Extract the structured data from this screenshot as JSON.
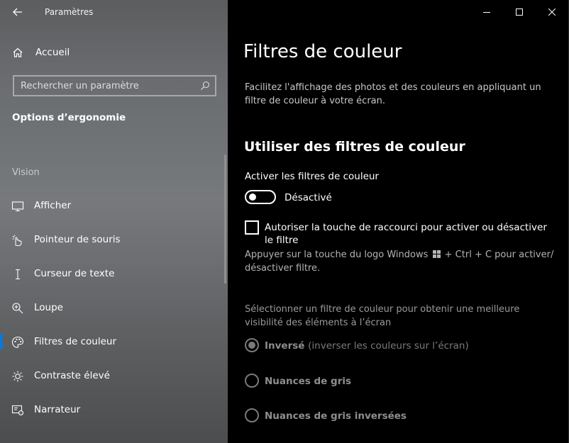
{
  "app": {
    "title": "Paramètres"
  },
  "sidebar": {
    "home_label": "Accueil",
    "search_placeholder": "Rechercher un paramètre",
    "section_title": "Options d’ergonomie",
    "group_label": "Vision",
    "items": [
      {
        "label": "Afficher",
        "icon": "display-icon"
      },
      {
        "label": "Pointeur de souris",
        "icon": "mouse-pointer-icon"
      },
      {
        "label": "Curseur de texte",
        "icon": "text-cursor-icon"
      },
      {
        "label": "Loupe",
        "icon": "magnifier-icon"
      },
      {
        "label": "Filtres de couleur",
        "icon": "palette-icon",
        "selected": true
      },
      {
        "label": "Contraste élevé",
        "icon": "contrast-icon"
      },
      {
        "label": "Narrateur",
        "icon": "narrator-icon"
      }
    ]
  },
  "main": {
    "title": "Filtres de couleur",
    "description": "Facilitez l'affichage des photos et des couleurs en appliquant un filtre de couleur à votre écran.",
    "subtitle": "Utiliser des filtres de couleur",
    "toggle": {
      "label": "Activer les filtres de couleur",
      "state_text": "Désactivé",
      "on": false
    },
    "shortcut": {
      "label": "Autoriser la touche de raccourci pour activer ou désactiver le filtre",
      "checked": false,
      "hint_before": "Appuyer sur la touche du logo Windows",
      "hint_after": "+ Ctrl + C pour activer/ désactiver filtre."
    },
    "select_label": "Sélectionner un filtre de couleur pour obtenir une meilleure visibilité des éléments à l’écran",
    "options": [
      {
        "label": "Inversé",
        "detail": "(inverser les couleurs sur l’écran)",
        "selected": true
      },
      {
        "label": "Nuances de gris",
        "detail": "",
        "selected": false
      },
      {
        "label": "Nuances de gris inversées",
        "detail": "",
        "selected": false
      }
    ]
  },
  "colors": {
    "accent": "#0a78d7",
    "background": "#000000",
    "disabled": "#7a7a7a"
  }
}
